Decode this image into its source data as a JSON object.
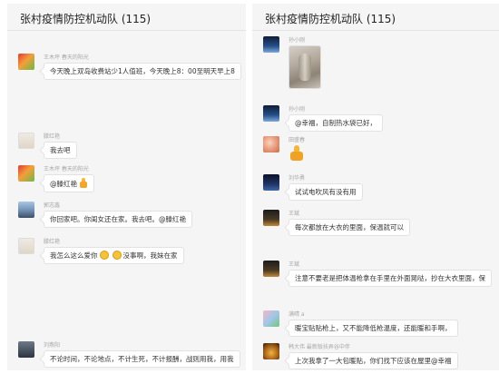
{
  "left": {
    "title": "张村疫情防控机动队 (115)",
    "messages": [
      {
        "sender": "王木坪 春天的阳光",
        "text": "今天晚上双岛收费站少1人值班，今天晚上8：00至明天早上8"
      },
      {
        "sender": "滕红艳",
        "text": "我去吧"
      },
      {
        "sender": "王木坪 春天的阳光",
        "text": "@滕红艳"
      },
      {
        "sender": "郭志鑫",
        "text": "你回家吧。你闺女还在家。我去吧。@滕红艳"
      },
      {
        "sender": "滕红艳",
        "text_a": "我怎么这么爱你",
        "text_b": "没事啊，我妹在家"
      },
      {
        "sender": "刘燕阳",
        "text": "不论时间，不论地点，不计生死，不计报酬，战则用我，用我"
      }
    ]
  },
  "right": {
    "title": "张村疫情防控机动队 (115)",
    "messages": [
      {
        "sender": "孙小刚"
      },
      {
        "sender": "孙小刚",
        "text": "@幸福，自制热水袋已好，"
      },
      {
        "sender": "田盛春"
      },
      {
        "sender": "刘华勇",
        "text": "试试电吹风有没有用"
      },
      {
        "sender": "王斌",
        "text": "每次都放在大衣的里面，保温就可以"
      },
      {
        "sender": "王斌",
        "text": "注意不要老是把体温枪拿在手里在外面晃哒，抄在大衣里面，保"
      },
      {
        "sender": "满晴 a",
        "text": "暖宝贴贴枪上，又不能降低枪温度，还能暖和手啊，"
      },
      {
        "sender": "韩大伟 最新版扶弄谷中伴",
        "text": "上次我拿了一大包暖贴，你们找下应该在屋里@幸福"
      }
    ]
  }
}
